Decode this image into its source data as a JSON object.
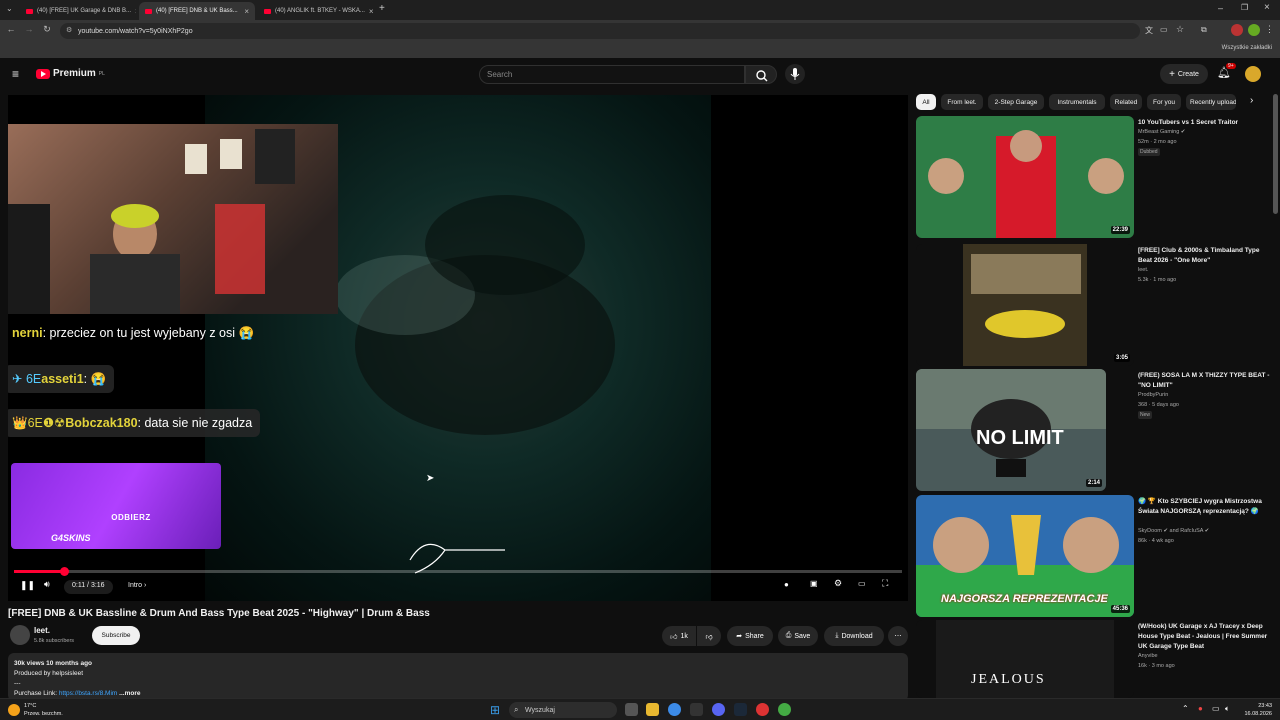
{
  "browser": {
    "tabs": [
      {
        "label": "(40) [FREE] UK Garage & DNB B...",
        "active": false
      },
      {
        "label": "(40) [FREE] DNB & UK Bass...",
        "active": true
      },
      {
        "label": "(40) ANGLIK ft. BTKEY - WSKA...",
        "active": false
      }
    ],
    "url": "youtube.com/watch?v=5y0iNXhP2go",
    "bookmarks_label": "Wszystkie zakładki"
  },
  "header": {
    "logo_label": "Premium",
    "logo_region": "PL",
    "search_placeholder": "Search",
    "create_label": "Create",
    "notifications_badge": "9+"
  },
  "player": {
    "chat": [
      {
        "nick": "nerni",
        "message": "przeciez on tu jest wyjebany z osi 😭",
        "nick_color": "#e3d33b"
      },
      {
        "nick": "asseti1",
        "message": "😭",
        "nick_color": "#e3d33b",
        "prefix": "✈ 6E"
      },
      {
        "nick": "Bobczak180",
        "message": "data sie nie zgadza",
        "nick_color": "#e3d33b",
        "prefix": "👑6E❶☢"
      }
    ],
    "ad_button": "ODBIERZ",
    "ad_logo": "G4SKINS",
    "time_current": "0:11",
    "time_total": "3:16",
    "time_text": "0:11 / 3:16",
    "chapter": "Intro",
    "progress": 0.056
  },
  "video": {
    "title": "[FREE] DNB & UK Bassline & Drum And Bass Type Beat 2025 - \"Highway\" | Drum & Bass",
    "channel": "leet.",
    "subscribers": "5.8k subscribers",
    "subscribe_label": "Subscribe",
    "likes": "1k",
    "share_label": "Share",
    "save_label": "Save",
    "download_label": "Download"
  },
  "description": {
    "stats": "30k views  10 months ago",
    "line2": "Produced by helpsisleet",
    "line3": "---",
    "purchase_prefix": "Purchase Link: ",
    "purchase_link": "https://bsta.rs/8.Mim",
    "more_label": "...more"
  },
  "chips": [
    "All",
    "From leet.",
    "2-Step Garage",
    "Instrumentals",
    "Related",
    "For you",
    "Recently uploaded"
  ],
  "recommendations": [
    {
      "title": "10 YouTubers vs 1 Secret Traitor",
      "channel": "MrBeast Gaming ✔",
      "meta": "52m · 2 mo ago",
      "badge": "Dubbed",
      "duration": "22:39",
      "thumb_color": "#2e7d46"
    },
    {
      "title": "[FREE] Club & 2000s & Timbaland Type Beat 2026 - \"One More\"",
      "channel": "leet.",
      "meta": "5.3k · 1 mo ago",
      "badge": "",
      "duration": "3:05",
      "thumb_color": "#3a3220"
    },
    {
      "title": "(FREE) SOSA LA M X THIZZY TYPE BEAT - \"NO LIMIT\"",
      "channel": "ProdbyPurin",
      "meta": "368 · 5 days ago",
      "badge": "New",
      "duration": "2:14",
      "thumb_color": "#4a5a5a",
      "thumb_text": "NO LIMIT"
    },
    {
      "title": "🌍 🏆 Kto SZYBCIEJ wygra Mistrzostwa Świata NAJGORSZĄ reprezentacją? 🌍",
      "channel": "SkyDoom ✔ and RafcIuSA ✔",
      "meta": "86k · 4 wk ago",
      "badge": "",
      "duration": "45:36",
      "thumb_color": "#2e6db0",
      "thumb_text": "NAJGORSZA REPREZENTACJE"
    },
    {
      "title": "(W/Hook) UK Garage x AJ Tracey x Deep House Type Beat - Jealous | Free Summer UK Garage Type Beat",
      "channel": "Anyvibe",
      "meta": "16k · 3 mo ago",
      "badge": "",
      "duration": "",
      "thumb_color": "#1a1a1a",
      "thumb_text": "JEALOUS"
    }
  ],
  "taskbar": {
    "weather_temp": "17°C",
    "weather_desc": "Przew. bezchm.",
    "search_label": "Wyszukaj",
    "time": "23:43",
    "date": "16.08.2026"
  },
  "colors": {
    "accent": "#ff0033",
    "link": "#3ea6ff",
    "chip_active": "#f1f1f1"
  }
}
